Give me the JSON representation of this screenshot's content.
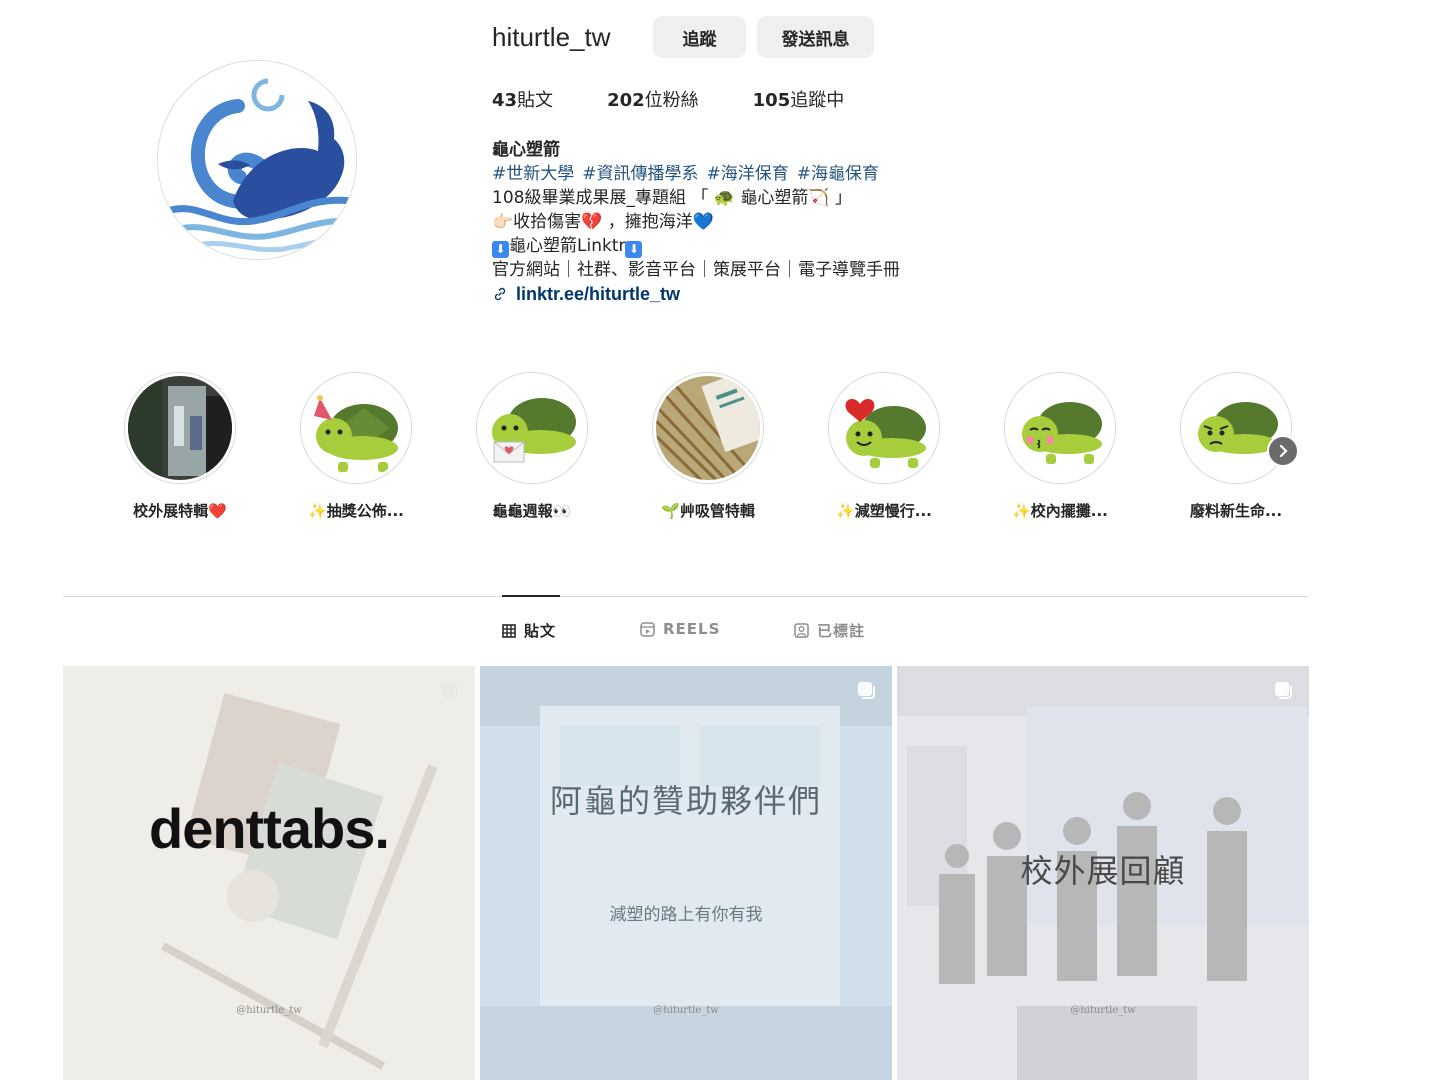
{
  "profile": {
    "username": "hiturtle_tw",
    "follow_label": "追蹤",
    "message_label": "發送訊息",
    "stats": {
      "posts": "43",
      "posts_label": "貼文",
      "followers": "202",
      "followers_label": "位粉絲",
      "following": "105",
      "following_label": "追蹤中"
    },
    "bio": {
      "name": "龜心塑箭",
      "hashtags": [
        "#世新大學",
        "#資訊傳播學系",
        "#海洋保育",
        "#海龜保育"
      ],
      "line1": "108級畢業成果展_專題組 「 🐢 龜心塑箭🏹 」",
      "line2": "👉🏻收拾傷害💔 ，擁抱海洋💙",
      "line3": "龜心塑箭Linktr",
      "line4": "官方網站｜社群、影音平台｜策展平台｜電子導覽手冊",
      "link": "linktr.ee/hiturtle_tw"
    }
  },
  "highlights": [
    {
      "label": "校外展特輯❤️"
    },
    {
      "label": "✨抽獎公佈..."
    },
    {
      "label": "龜龜週報👀"
    },
    {
      "label": "🌱艸吸管特輯"
    },
    {
      "label": "✨減塑慢行..."
    },
    {
      "label": "✨校內擺攤..."
    },
    {
      "label": "廢料新生命..."
    }
  ],
  "tabs": {
    "posts": "貼文",
    "reels": "REELS",
    "tagged": "已標註"
  },
  "posts": [
    {
      "title": "denttabs.",
      "watermark": "@hiturtle_tw"
    },
    {
      "title": "阿龜的贊助夥伴們",
      "subtitle": "減塑的路上有你有我",
      "watermark": "@hiturtle_tw"
    },
    {
      "title": "校外展回顧",
      "watermark": "@hiturtle_tw"
    }
  ],
  "colors": {
    "link": "#00376b",
    "button_bg": "#efefef",
    "border": "#dbdbdb",
    "logo_blue": "#2a4f9e",
    "logo_light": "#7fb6e0"
  }
}
